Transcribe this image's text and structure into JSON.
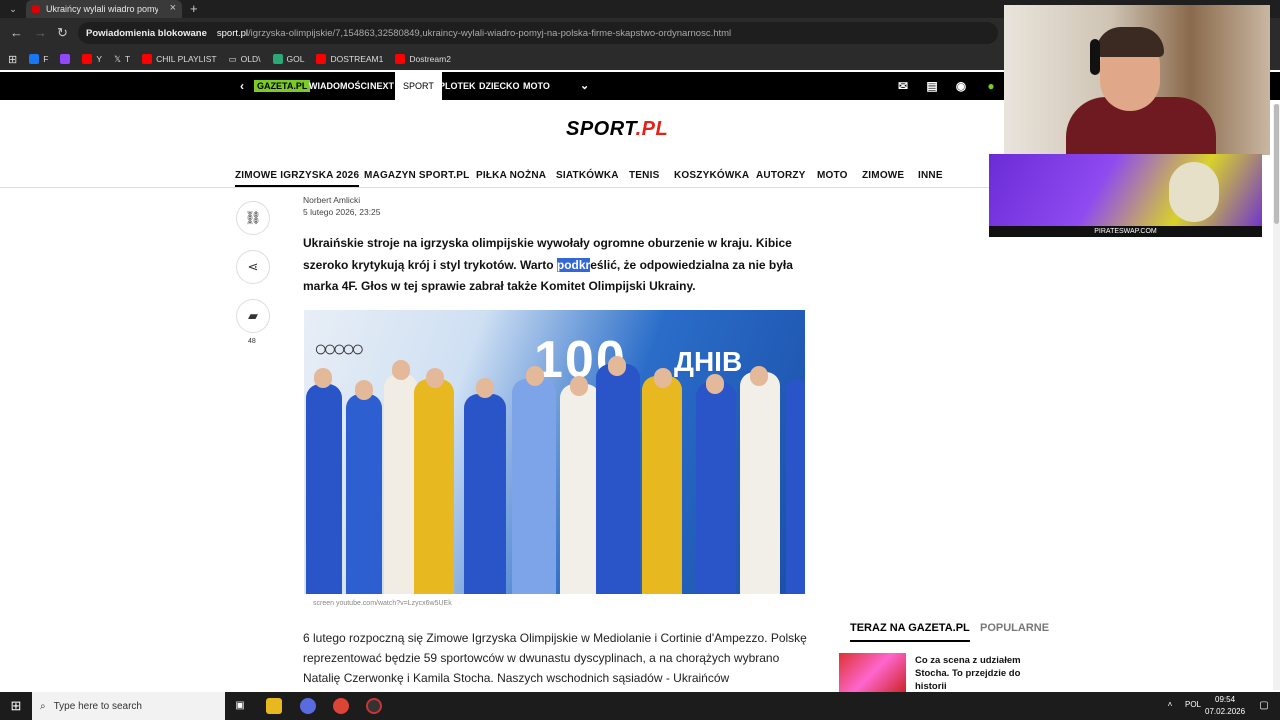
{
  "browser": {
    "tab_title": "Ukraińcy wylali wiadro pomyj na polską firmę",
    "blocked_label": "Powiadomienia blokowane",
    "url_domain": "sport.pl",
    "url_path": "/igrzyska-olimpijskie/7,154863,32580849,ukraincy-wylali-wiadro-pomyj-na-polska-firme-skapstwo-ordynarnosc.html",
    "bookmarks": [
      {
        "label": "F",
        "color": "#1877f2"
      },
      {
        "label": "",
        "color": "#9146ff"
      },
      {
        "label": "Y",
        "color": "#ff0000"
      },
      {
        "label": "T",
        "color": "#000000"
      },
      {
        "label": "CHIL PLAYLIST",
        "color": "#ff0000"
      },
      {
        "label": "OLD\\",
        "color": "#888888"
      },
      {
        "label": "GOL",
        "color": "#2aa876"
      },
      {
        "label": "DOSTREAM1",
        "color": "#ff0000"
      },
      {
        "label": "Dostream2",
        "color": "#ff0000"
      }
    ]
  },
  "gazeta_nav": {
    "logo": "GAZETA.PL",
    "items": [
      "WIADOMOŚCI",
      "NEXT",
      "SPORT",
      "PLOTEK",
      "DZIECKO",
      "MOTO"
    ]
  },
  "site": {
    "logo_main": "SPORT",
    "logo_suffix": ".PL",
    "categories": [
      "ZIMOWE IGRZYSKA 2026",
      "MAGAZYN SPORT.PL",
      "PIŁKA NOŻNA",
      "SIATKÓWKA",
      "TENIS",
      "KOSZYKÓWKA",
      "AUTORZY",
      "MOTO",
      "ZIMOWE",
      "INNE"
    ]
  },
  "article": {
    "author": "Norbert Amlicki",
    "date": "5 lutego 2026, 23:25",
    "comment_count": "48",
    "lead_before": "Ukraińskie stroje na igrzyska olimpijskie wywołały ogromne oburzenie w kraju. Kibice szeroko krytykują krój i styl trykotów. Warto ",
    "lead_highlight": "podkr",
    "lead_after": "eślić, że odpowiedzialna za nie była marka 4F. Głos w tej sprawie zabrał także Komitet Olimpijski Ukrainy.",
    "photo_text_big": "100",
    "photo_text_small": "ДНІВ",
    "photo_caption": "screen youtube.com/watch?v=Lzycx6w5UEk",
    "body": "6 lutego rozpoczną się Zimowe Igrzyska Olimpijskie w Mediolanie i Cortinie d'Ampezzo. Polskę reprezentować będzie 59 sportowców w dwunastu dyscyplinach, a na chorążych wybrano Natalię Czerwonkę i Kamila Stocha. Naszych wschodnich sąsiadów - Ukraińców"
  },
  "sidebar": {
    "tab_now": "TERAZ NA GAZETA.PL",
    "tab_popular": "POPULARNE",
    "item_title": "Co za scena z udziałem Stocha. To przejdzie do historii"
  },
  "ad": {
    "brand": "PIRATESWAP.COM"
  },
  "taskbar": {
    "search_placeholder": "Type here to search",
    "lang": "POL",
    "time": "09:54",
    "date": "07.02.2026"
  }
}
